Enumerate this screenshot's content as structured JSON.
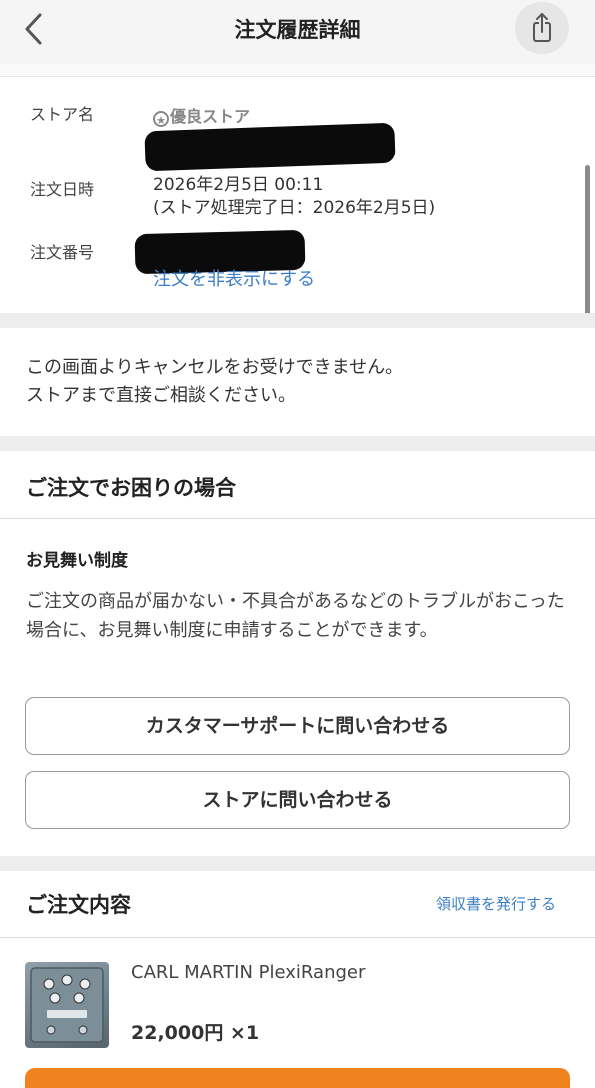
{
  "header": {
    "title": "注文履歴詳細"
  },
  "store_info": {
    "store_label": "ストア名",
    "badge_label": "優良ストア",
    "date_label": "注文日時",
    "date_value": "2026年2月5日 00:11",
    "store_processed": "(ストア処理完了日：2026年2月5日)",
    "order_no_label": "注文番号",
    "hide_link": "注文を非表示にする"
  },
  "notice": {
    "line1": "この画面よりキャンセルをお受けできません。",
    "line2": "ストアまで直接ご相談ください。"
  },
  "trouble": {
    "heading": "ご注文でお困りの場合",
    "subheading": "お見舞い制度",
    "description": "ご注文の商品が届かない・不具合があるなどのトラブルがおこった場合に、お見舞い制度に申請することができます。",
    "customer_support_button": "カスタマーサポートに問い合わせる",
    "store_contact_button": "ストアに問い合わせる"
  },
  "order": {
    "heading": "ご注文内容",
    "receipt_link": "領収書を発行する",
    "items": [
      {
        "name": "CARL MARTIN PlexiRanger",
        "price": "22,000円 ×1"
      }
    ]
  },
  "icons": {
    "back": "chevron-left-icon",
    "share": "share-icon",
    "badge": "star-badge-icon"
  },
  "colors": {
    "link": "#3d7fc4",
    "accent": "#f0831e",
    "section_band": "#ededed"
  }
}
